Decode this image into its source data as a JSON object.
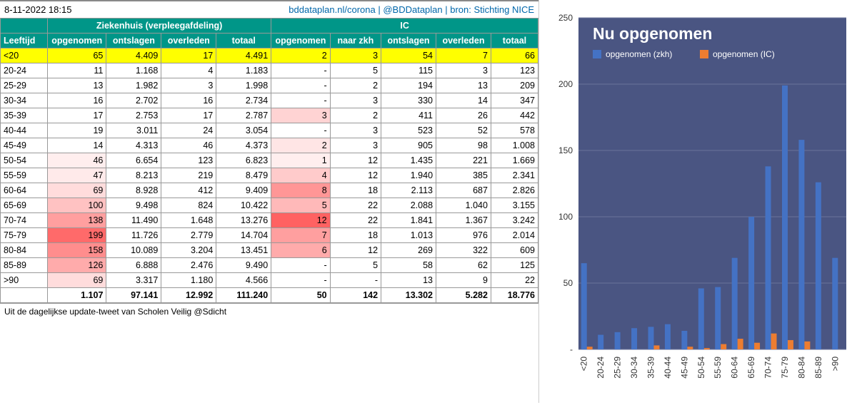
{
  "timestamp": "8-11-2022 18:15",
  "source_line": "bddataplan.nl/corona | @BDDataplan | bron: Stichting NICE",
  "footer": "Uit de dagelijkse update-tweet van Scholen Veilig @Sdicht",
  "headers": {
    "group_hosp": "Ziekenhuis (verpleegafdeling)",
    "group_ic": "IC",
    "age": "Leeftijd",
    "h_opgenomen": "opgenomen",
    "h_ontslagen": "ontslagen",
    "h_overleden": "overleden",
    "h_totaal": "totaal",
    "i_opgenomen": "opgenomen",
    "i_naarzkh": "naar zkh",
    "i_ontslagen": "ontslagen",
    "i_overleden": "overleden",
    "i_totaal": "totaal"
  },
  "rows": [
    {
      "age": "<20",
      "h_op": "65",
      "h_ont": "4.409",
      "h_ov": "17",
      "h_tot": "4.491",
      "i_op": "2",
      "i_nz": "3",
      "i_ont": "54",
      "i_ov": "7",
      "i_tot": "66",
      "hl": true,
      "heat_h": 0,
      "heat_i": 0.05
    },
    {
      "age": "20-24",
      "h_op": "11",
      "h_ont": "1.168",
      "h_ov": "4",
      "h_tot": "1.183",
      "i_op": "-",
      "i_nz": "5",
      "i_ont": "115",
      "i_ov": "3",
      "i_tot": "123",
      "heat_h": 0,
      "heat_i": 0
    },
    {
      "age": "25-29",
      "h_op": "13",
      "h_ont": "1.982",
      "h_ov": "3",
      "h_tot": "1.998",
      "i_op": "-",
      "i_nz": "2",
      "i_ont": "194",
      "i_ov": "13",
      "i_tot": "209",
      "heat_h": 0,
      "heat_i": 0
    },
    {
      "age": "30-34",
      "h_op": "16",
      "h_ont": "2.702",
      "h_ov": "16",
      "h_tot": "2.734",
      "i_op": "-",
      "i_nz": "3",
      "i_ont": "330",
      "i_ov": "14",
      "i_tot": "347",
      "heat_h": 0,
      "heat_i": 0
    },
    {
      "age": "35-39",
      "h_op": "17",
      "h_ont": "2.753",
      "h_ov": "17",
      "h_tot": "2.787",
      "i_op": "3",
      "i_nz": "2",
      "i_ont": "411",
      "i_ov": "26",
      "i_tot": "442",
      "heat_h": 0,
      "heat_i": 0.25
    },
    {
      "age": "40-44",
      "h_op": "19",
      "h_ont": "3.011",
      "h_ov": "24",
      "h_tot": "3.054",
      "i_op": "-",
      "i_nz": "3",
      "i_ont": "523",
      "i_ov": "52",
      "i_tot": "578",
      "heat_h": 0,
      "heat_i": 0
    },
    {
      "age": "45-49",
      "h_op": "14",
      "h_ont": "4.313",
      "h_ov": "46",
      "h_tot": "4.373",
      "i_op": "2",
      "i_nz": "3",
      "i_ont": "905",
      "i_ov": "98",
      "i_tot": "1.008",
      "heat_h": 0,
      "heat_i": 0.15
    },
    {
      "age": "50-54",
      "h_op": "46",
      "h_ont": "6.654",
      "h_ov": "123",
      "h_tot": "6.823",
      "i_op": "1",
      "i_nz": "12",
      "i_ont": "1.435",
      "i_ov": "221",
      "i_tot": "1.669",
      "heat_h": 0.1,
      "heat_i": 0.1
    },
    {
      "age": "55-59",
      "h_op": "47",
      "h_ont": "8.213",
      "h_ov": "219",
      "h_tot": "8.479",
      "i_op": "4",
      "i_nz": "12",
      "i_ont": "1.940",
      "i_ov": "385",
      "i_tot": "2.341",
      "heat_h": 0.12,
      "heat_i": 0.3
    },
    {
      "age": "60-64",
      "h_op": "69",
      "h_ont": "8.928",
      "h_ov": "412",
      "h_tot": "9.409",
      "i_op": "8",
      "i_nz": "18",
      "i_ont": "2.113",
      "i_ov": "687",
      "i_tot": "2.826",
      "heat_h": 0.2,
      "heat_i": 0.6
    },
    {
      "age": "65-69",
      "h_op": "100",
      "h_ont": "9.498",
      "h_ov": "824",
      "h_tot": "10.422",
      "i_op": "5",
      "i_nz": "22",
      "i_ont": "2.088",
      "i_ov": "1.040",
      "i_tot": "3.155",
      "heat_h": 0.35,
      "heat_i": 0.4
    },
    {
      "age": "70-74",
      "h_op": "138",
      "h_ont": "11.490",
      "h_ov": "1.648",
      "h_tot": "13.276",
      "i_op": "12",
      "i_nz": "22",
      "i_ont": "1.841",
      "i_ov": "1.367",
      "i_tot": "3.242",
      "heat_h": 0.55,
      "heat_i": 0.9
    },
    {
      "age": "75-79",
      "h_op": "199",
      "h_ont": "11.726",
      "h_ov": "2.779",
      "h_tot": "14.704",
      "i_op": "7",
      "i_nz": "18",
      "i_ont": "1.013",
      "i_ov": "976",
      "i_tot": "2.014",
      "heat_h": 0.85,
      "heat_i": 0.55
    },
    {
      "age": "80-84",
      "h_op": "158",
      "h_ont": "10.089",
      "h_ov": "3.204",
      "h_tot": "13.451",
      "i_op": "6",
      "i_nz": "12",
      "i_ont": "269",
      "i_ov": "322",
      "i_tot": "609",
      "heat_h": 0.65,
      "heat_i": 0.48
    },
    {
      "age": "85-89",
      "h_op": "126",
      "h_ont": "6.888",
      "h_ov": "2.476",
      "h_tot": "9.490",
      "i_op": "-",
      "i_nz": "5",
      "i_ont": "58",
      "i_ov": "62",
      "i_tot": "125",
      "heat_h": 0.48,
      "heat_i": 0
    },
    {
      "age": ">90",
      "h_op": "69",
      "h_ont": "3.317",
      "h_ov": "1.180",
      "h_tot": "4.566",
      "i_op": "-",
      "i_nz": "-",
      "i_ont": "13",
      "i_ov": "9",
      "i_tot": "22",
      "heat_h": 0.2,
      "heat_i": 0
    }
  ],
  "totals": {
    "age": "",
    "h_op": "1.107",
    "h_ont": "97.141",
    "h_ov": "12.992",
    "h_tot": "111.240",
    "i_op": "50",
    "i_nz": "142",
    "i_ont": "13.302",
    "i_ov": "5.282",
    "i_tot": "18.776"
  },
  "chart_data": {
    "type": "bar",
    "title": "Nu opgenomen",
    "categories": [
      "<20",
      "20-24",
      "25-29",
      "30-34",
      "35-39",
      "40-44",
      "45-49",
      "50-54",
      "55-59",
      "60-64",
      "65-69",
      "70-74",
      "75-79",
      "80-84",
      "85-89",
      ">90"
    ],
    "series": [
      {
        "name": "opgenomen (zkh)",
        "color": "#4472C4",
        "values": [
          65,
          11,
          13,
          16,
          17,
          19,
          14,
          46,
          47,
          69,
          100,
          138,
          199,
          158,
          126,
          69
        ]
      },
      {
        "name": "opgenomen (IC)",
        "color": "#ED7D31",
        "values": [
          2,
          0,
          0,
          0,
          3,
          0,
          2,
          1,
          4,
          8,
          5,
          12,
          7,
          6,
          0,
          0
        ]
      }
    ],
    "ylim": [
      0,
      250
    ],
    "yticks": [
      0,
      50,
      100,
      150,
      200,
      250
    ],
    "ylabel": "",
    "xlabel": ""
  }
}
